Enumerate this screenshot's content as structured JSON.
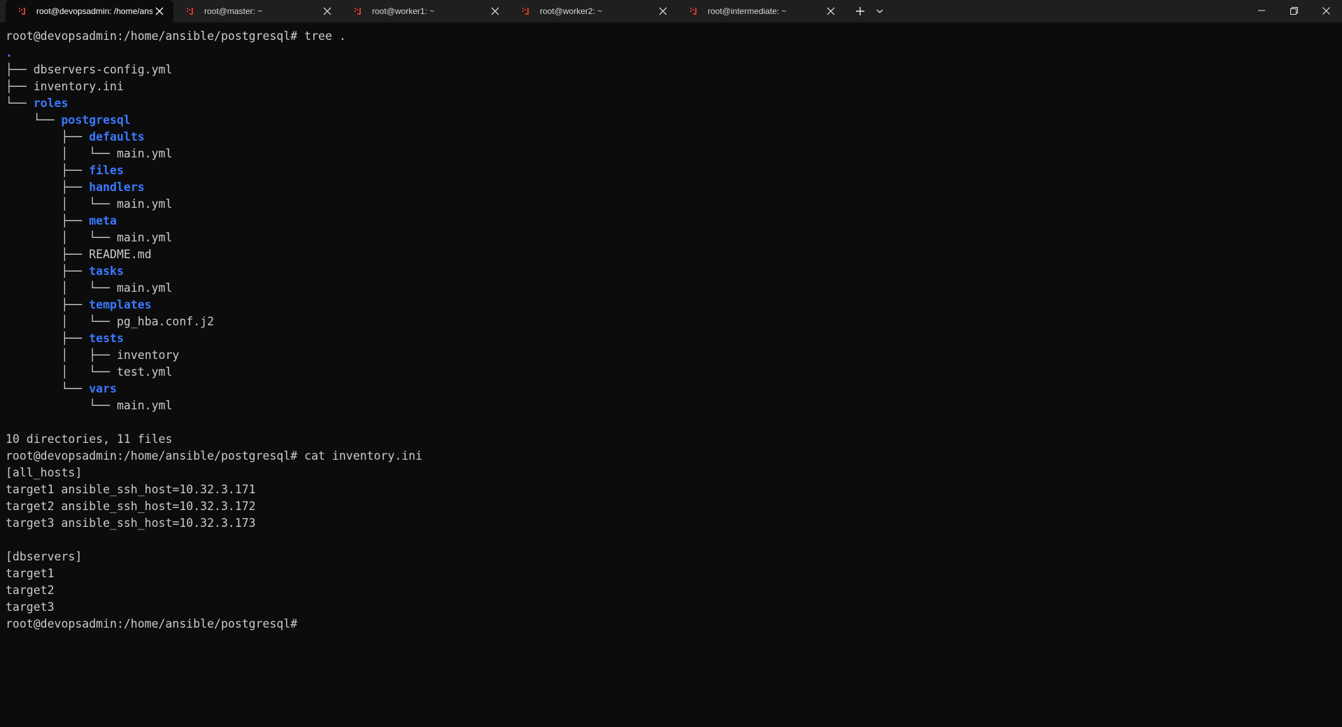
{
  "window": {
    "tabs": [
      {
        "title": "root@devopsadmin: /home/ansible/postgresql",
        "active": true
      },
      {
        "title": "root@master: ~",
        "active": false
      },
      {
        "title": "root@worker1: ~",
        "active": false
      },
      {
        "title": "root@worker2: ~",
        "active": false
      },
      {
        "title": "root@intermediate: ~",
        "active": false
      }
    ],
    "icons": {
      "tab_icon": "ubuntu-icon",
      "close": "close-icon",
      "new_tab": "plus-icon",
      "dropdown": "chevron-down-icon",
      "minimize": "minimize-icon",
      "maximize": "restore-icon",
      "window_close": "window-close-icon"
    },
    "colors": {
      "tab_icon": "#e0342c",
      "directory": "#3b78ff",
      "text": "#cccccc",
      "background": "#0c0c0c"
    }
  },
  "terminal": {
    "lines": [
      {
        "prefix": "",
        "text": "root@devopsadmin:/home/ansible/postgresql# tree .",
        "kind": "plain"
      },
      {
        "prefix": "",
        "text": ".",
        "kind": "dir"
      },
      {
        "prefix": "├── ",
        "text": "dbservers-config.yml",
        "kind": "file"
      },
      {
        "prefix": "├── ",
        "text": "inventory.ini",
        "kind": "file"
      },
      {
        "prefix": "└── ",
        "text": "roles",
        "kind": "dir"
      },
      {
        "prefix": "    └── ",
        "text": "postgresql",
        "kind": "dir"
      },
      {
        "prefix": "        ├── ",
        "text": "defaults",
        "kind": "dir"
      },
      {
        "prefix": "        │   └── ",
        "text": "main.yml",
        "kind": "file"
      },
      {
        "prefix": "        ├── ",
        "text": "files",
        "kind": "dir"
      },
      {
        "prefix": "        ├── ",
        "text": "handlers",
        "kind": "dir"
      },
      {
        "prefix": "        │   └── ",
        "text": "main.yml",
        "kind": "file"
      },
      {
        "prefix": "        ├── ",
        "text": "meta",
        "kind": "dir"
      },
      {
        "prefix": "        │   └── ",
        "text": "main.yml",
        "kind": "file"
      },
      {
        "prefix": "        ├── ",
        "text": "README.md",
        "kind": "file"
      },
      {
        "prefix": "        ├── ",
        "text": "tasks",
        "kind": "dir"
      },
      {
        "prefix": "        │   └── ",
        "text": "main.yml",
        "kind": "file"
      },
      {
        "prefix": "        ├── ",
        "text": "templates",
        "kind": "dir"
      },
      {
        "prefix": "        │   └── ",
        "text": "pg_hba.conf.j2",
        "kind": "file"
      },
      {
        "prefix": "        ├── ",
        "text": "tests",
        "kind": "dir"
      },
      {
        "prefix": "        │   ├── ",
        "text": "inventory",
        "kind": "file"
      },
      {
        "prefix": "        │   └── ",
        "text": "test.yml",
        "kind": "file"
      },
      {
        "prefix": "        └── ",
        "text": "vars",
        "kind": "dir"
      },
      {
        "prefix": "            └── ",
        "text": "main.yml",
        "kind": "file"
      },
      {
        "prefix": "",
        "text": "",
        "kind": "plain"
      },
      {
        "prefix": "",
        "text": "10 directories, 11 files",
        "kind": "plain"
      },
      {
        "prefix": "",
        "text": "root@devopsadmin:/home/ansible/postgresql# cat inventory.ini",
        "kind": "plain"
      },
      {
        "prefix": "",
        "text": "[all_hosts]",
        "kind": "plain"
      },
      {
        "prefix": "",
        "text": "target1 ansible_ssh_host=10.32.3.171",
        "kind": "plain"
      },
      {
        "prefix": "",
        "text": "target2 ansible_ssh_host=10.32.3.172",
        "kind": "plain"
      },
      {
        "prefix": "",
        "text": "target3 ansible_ssh_host=10.32.3.173",
        "kind": "plain"
      },
      {
        "prefix": "",
        "text": "",
        "kind": "plain"
      },
      {
        "prefix": "",
        "text": "[dbservers]",
        "kind": "plain"
      },
      {
        "prefix": "",
        "text": "target1",
        "kind": "plain"
      },
      {
        "prefix": "",
        "text": "target2",
        "kind": "plain"
      },
      {
        "prefix": "",
        "text": "target3",
        "kind": "plain"
      },
      {
        "prefix": "",
        "text": "root@devopsadmin:/home/ansible/postgresql# ",
        "kind": "plain"
      }
    ]
  }
}
